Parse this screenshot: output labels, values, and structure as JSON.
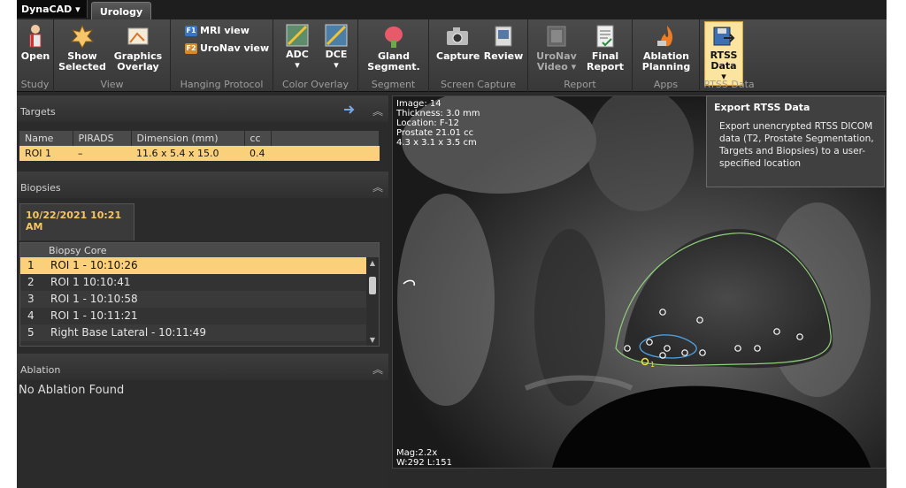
{
  "app": {
    "brand": "DynaCAD",
    "tab": "Urology"
  },
  "ribbon": {
    "groups": {
      "study": "Study",
      "view": "View",
      "hanging": "Hanging Protocol",
      "color": "Color Overlay",
      "segment": "Segment",
      "capture": "Screen Capture",
      "report": "Report",
      "apps": "Apps",
      "rtss": "RTSS Data"
    },
    "buttons": {
      "open": "Open",
      "show_selected": [
        "Show",
        "Selected"
      ],
      "graphics_overlay": [
        "Graphics",
        "Overlay"
      ],
      "mri_view": "MRI view",
      "uronav_view": "UroNav view",
      "f1": "F1",
      "f2": "F2",
      "adc": "ADC",
      "dce": "DCE",
      "gland_segment": [
        "Gland",
        "Segment."
      ],
      "capture": "Capture",
      "review": "Review",
      "uronav_video": [
        "UroNav",
        "Video ▾"
      ],
      "final_report": [
        "Final",
        "Report"
      ],
      "ablation_planning": [
        "Ablation",
        "Planning"
      ],
      "rtss_data": [
        "RTSS",
        "Data ▾"
      ]
    }
  },
  "tooltip": {
    "title": "Export RTSS Data",
    "body": "Export unencrypted RTSS DICOM data (T2, Prostate Segmentation, Targets and Biopsies) to a user-specified location"
  },
  "targets": {
    "title": "Targets",
    "columns": [
      "Name",
      "PIRADS",
      "Dimension (mm)",
      "cc"
    ],
    "rows": [
      {
        "name": "ROI 1",
        "pirads": "–",
        "dimension": "11.6 x 5.4 x 15.0",
        "cc": "0.4"
      }
    ]
  },
  "biopsies": {
    "title": "Biopsies",
    "tab": "10/22/2021 10:21 AM",
    "column": "Biopsy Core",
    "rows": [
      {
        "n": "1",
        "label": "ROI 1 - 10:10:26"
      },
      {
        "n": "2",
        "label": "ROI 1    10:10:41"
      },
      {
        "n": "3",
        "label": "ROI 1 - 10:10:58"
      },
      {
        "n": "4",
        "label": "ROI 1 - 10:11:21"
      },
      {
        "n": "5",
        "label": "Right Base Lateral - 10:11:49"
      }
    ]
  },
  "ablation": {
    "title": "Ablation",
    "empty": "No Ablation Found"
  },
  "viewer": {
    "info": [
      "Image: 14",
      "Thickness: 3.0 mm",
      "Location: F-12",
      "Prostate 21.01 cc",
      "4.3 x 3.1 x 3.5 cm"
    ],
    "mag": "Mag:2.2x",
    "wl": "W:292 L:151",
    "marker_label": "1"
  }
}
